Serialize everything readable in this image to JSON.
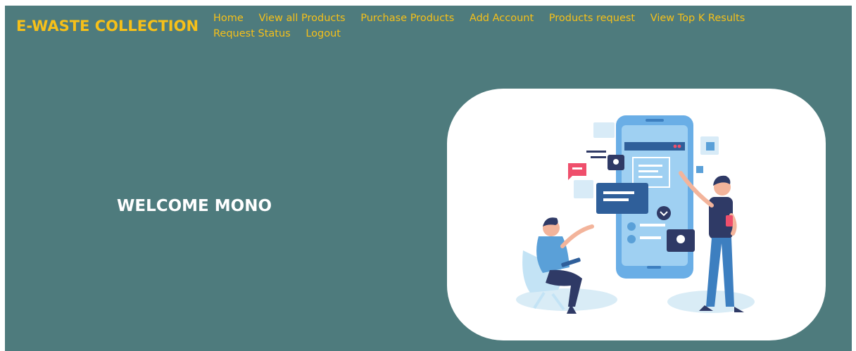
{
  "brand": {
    "title": "E-WASTE COLLECTION"
  },
  "nav": {
    "items": [
      {
        "label": "Home"
      },
      {
        "label": "View all Products"
      },
      {
        "label": "Purchase Products"
      },
      {
        "label": "Add Account"
      },
      {
        "label": "Products request"
      },
      {
        "label": "View Top K Results"
      },
      {
        "label": "Request Status"
      },
      {
        "label": "Logout"
      }
    ]
  },
  "main": {
    "welcome": "WELCOME MONO"
  },
  "colors": {
    "background": "#4e7b7d",
    "brand": "#f6c019",
    "heading": "#ffffff",
    "phone": "#6aaee6",
    "accent": "#ef4f6c"
  }
}
